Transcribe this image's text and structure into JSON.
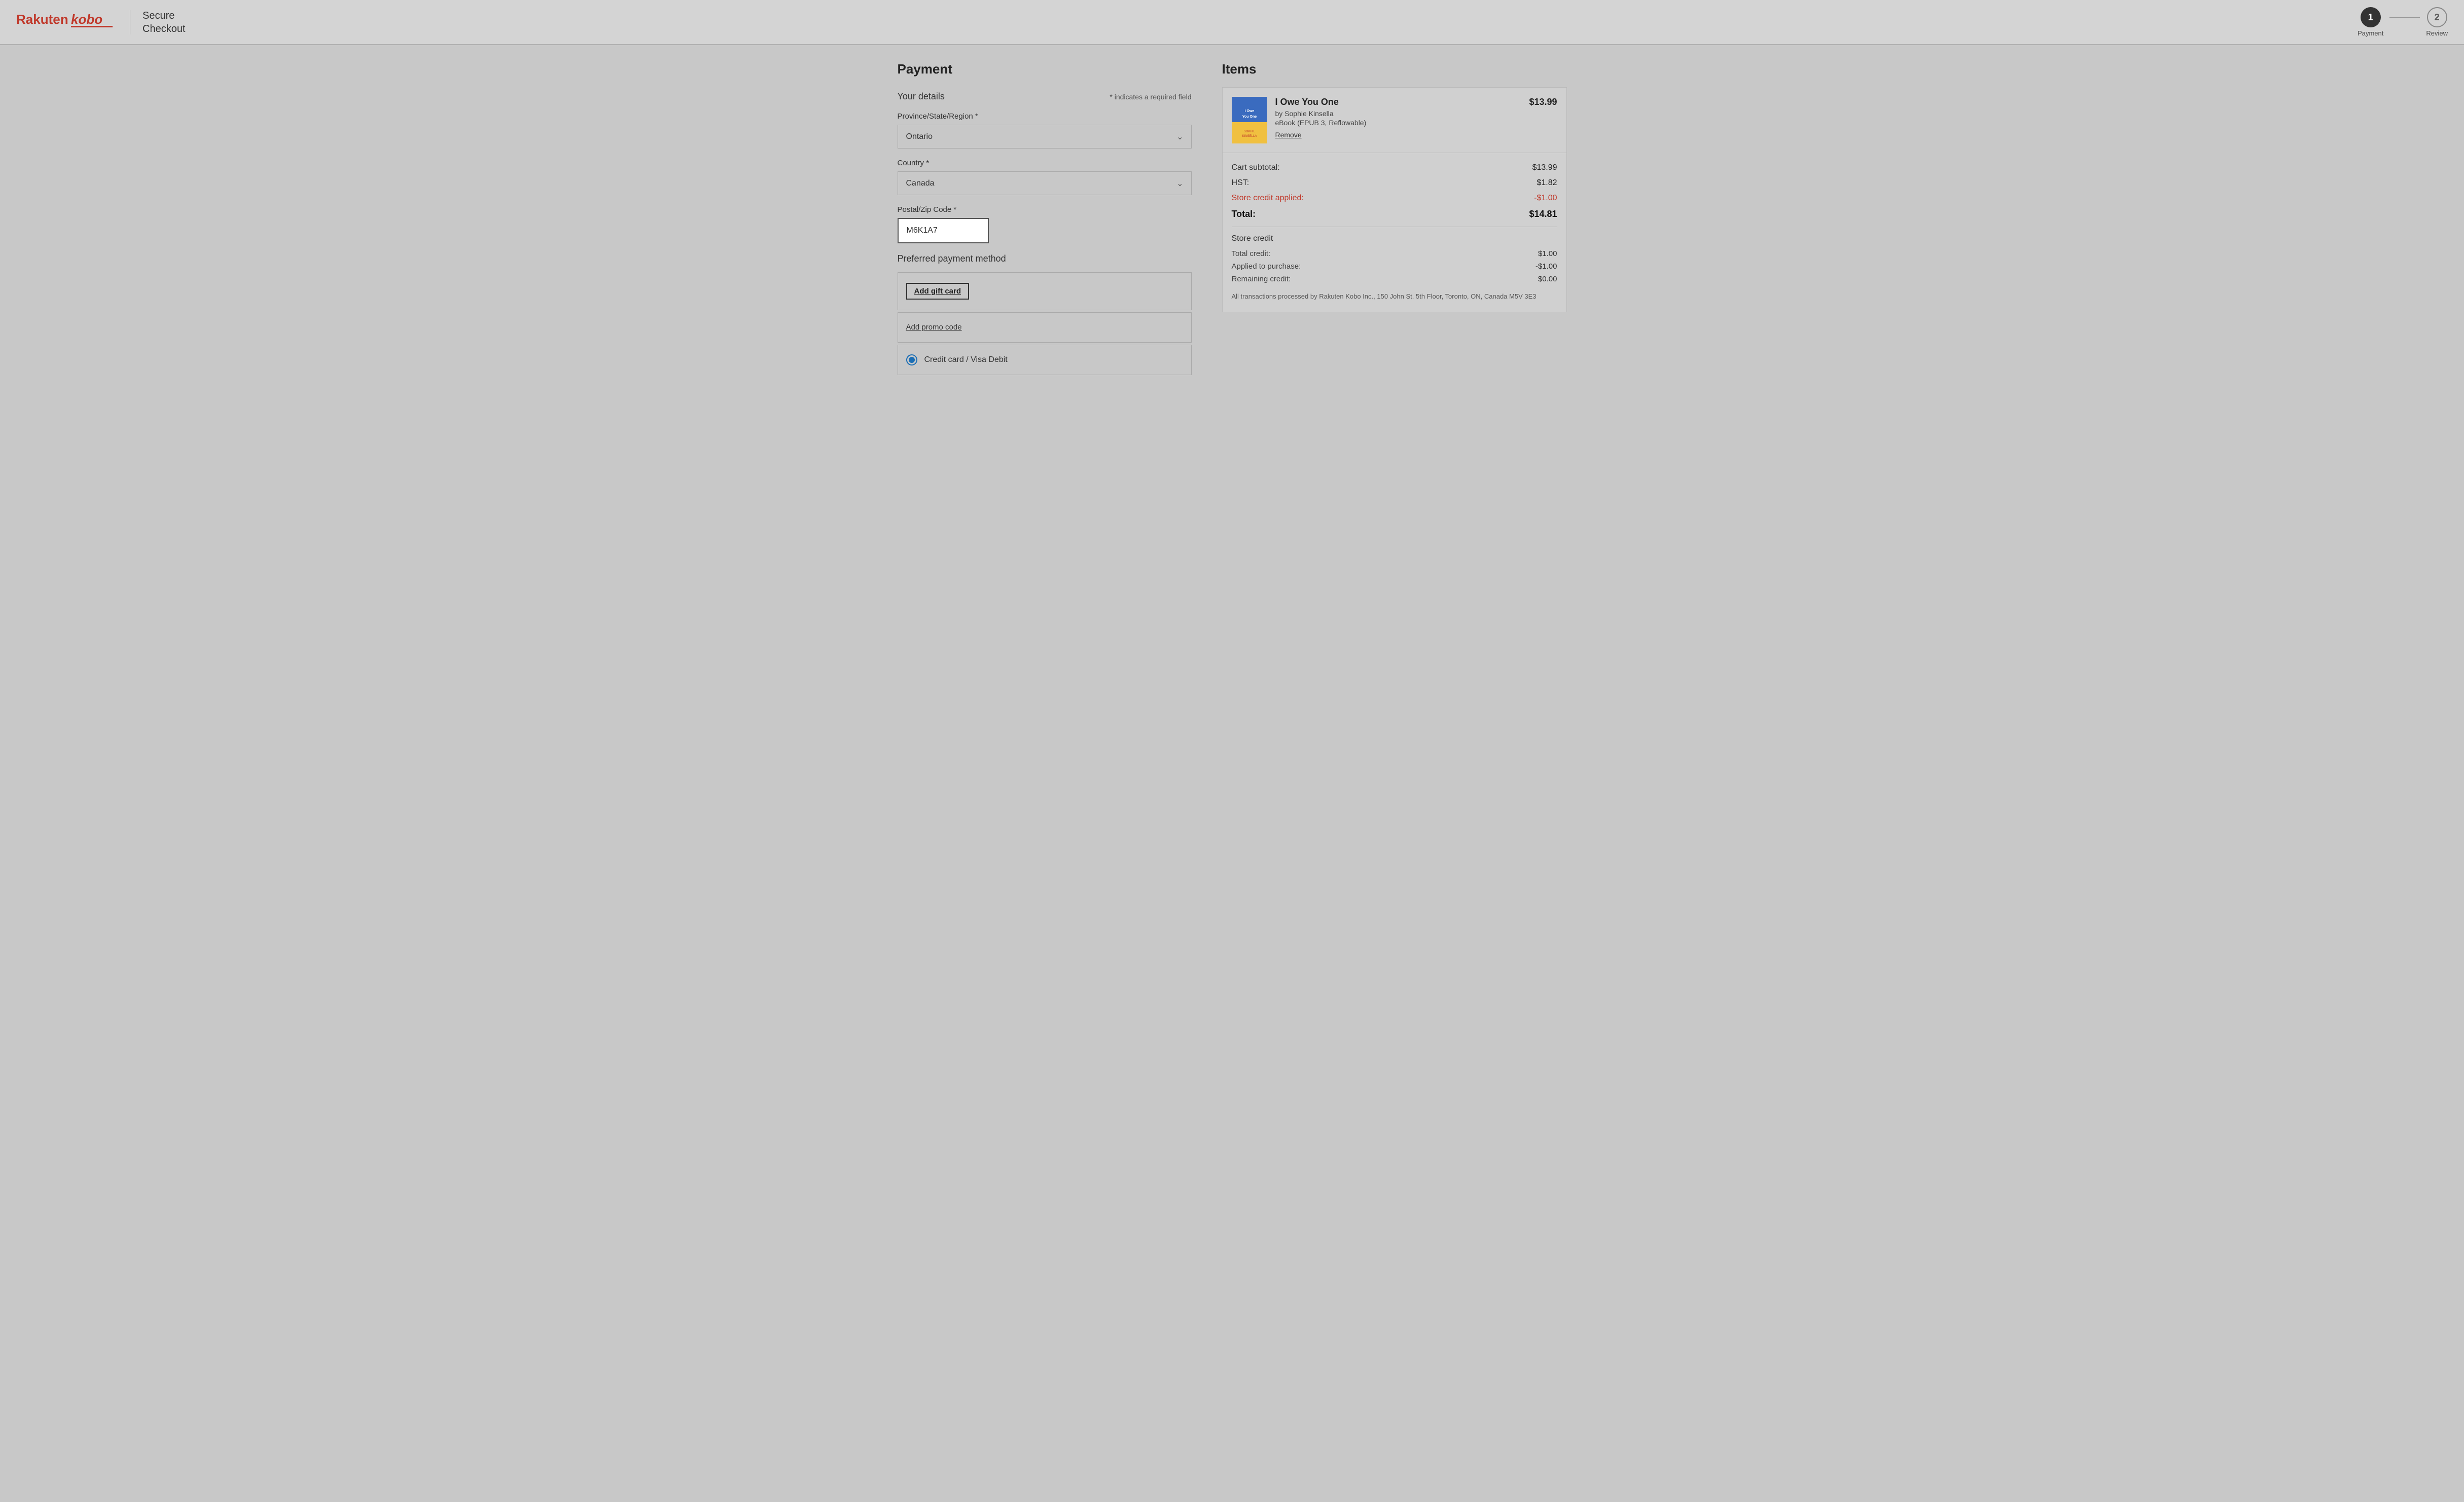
{
  "header": {
    "logo_rakuten": "Rakuten",
    "logo_kobo": "kobo",
    "secure_checkout_line1": "Secure",
    "secure_checkout_line2": "Checkout",
    "steps": [
      {
        "number": "1",
        "label": "Payment",
        "active": true
      },
      {
        "number": "2",
        "label": "Review",
        "active": false
      }
    ]
  },
  "left": {
    "section_title": "Payment",
    "your_details_title": "Your details",
    "required_note": "* indicates a required field",
    "province_label": "Province/State/Region *",
    "province_value": "Ontario",
    "country_label": "Country *",
    "country_value": "Canada",
    "postal_label": "Postal/Zip Code *",
    "postal_value": "M6K1A7",
    "preferred_payment_title": "Preferred payment method",
    "add_gift_card_label": "Add gift card",
    "add_promo_label": "Add promo code",
    "credit_card_label": "Credit card / Visa Debit"
  },
  "right": {
    "section_title": "Items",
    "item": {
      "title": "I Owe You One",
      "author": "by Sophie Kinsella",
      "format": "eBook (EPUB 3, Reflowable)",
      "price": "$13.99",
      "remove_label": "Remove",
      "cover_text": "I Owe You One"
    },
    "cart_subtotal_label": "Cart subtotal:",
    "cart_subtotal_value": "$13.99",
    "hst_label": "HST:",
    "hst_value": "$1.82",
    "store_credit_applied_label": "Store credit applied:",
    "store_credit_applied_value": "-$1.00",
    "total_label": "Total:",
    "total_value": "$14.81",
    "store_credit_section_title": "Store credit",
    "total_credit_label": "Total credit:",
    "total_credit_value": "$1.00",
    "applied_to_purchase_label": "Applied to purchase:",
    "applied_to_purchase_value": "-$1.00",
    "remaining_credit_label": "Remaining credit:",
    "remaining_credit_value": "$0.00",
    "footer_note": "All transactions processed by Rakuten Kobo Inc., 150 John St. 5th Floor, Toronto, ON, Canada M5V 3E3"
  }
}
